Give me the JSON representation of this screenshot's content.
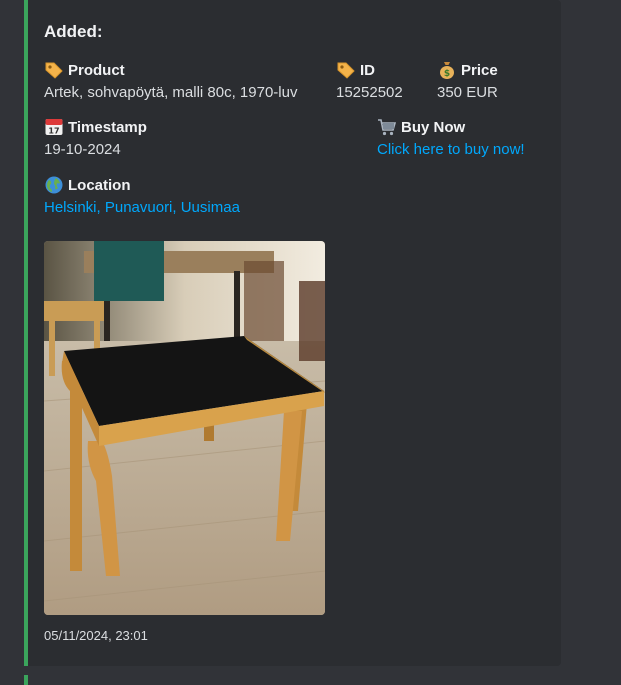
{
  "embed": {
    "title": "Added:",
    "accent_color": "#3ba55c",
    "fields": {
      "product": {
        "icon": "label-icon",
        "name": "Product",
        "value": "Artek, sohvapöytä, malli 80c, 1970-luv"
      },
      "id": {
        "icon": "label-icon",
        "name": "ID",
        "value": "15252502"
      },
      "price": {
        "icon": "money-bag-icon",
        "name": "Price",
        "value": "350 EUR"
      },
      "timestamp": {
        "icon": "calendar-icon",
        "name": "Timestamp",
        "value": "19-10-2024"
      },
      "buy_now": {
        "icon": "shopping-cart-icon",
        "name": "Buy Now",
        "value": "Click here to buy now!"
      },
      "location": {
        "icon": "globe-icon",
        "name": "Location",
        "value": "Helsinki, Punavuori, Uusimaa"
      }
    },
    "footer": {
      "timestamp": "05/11/2024, 23:01"
    },
    "link_color": "#00a8fc"
  }
}
